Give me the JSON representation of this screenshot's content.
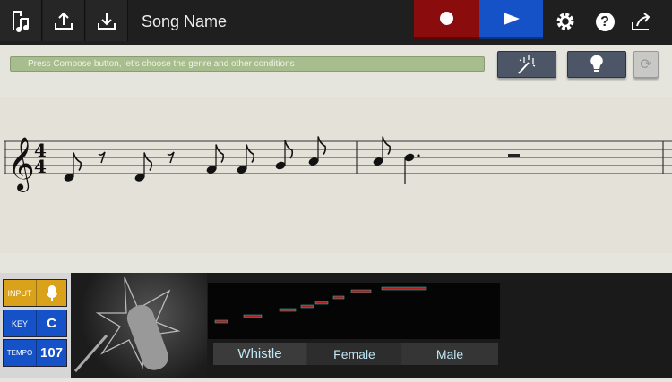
{
  "header": {
    "song_name": "Song Name",
    "icons": [
      "score-file-icon",
      "upload-icon",
      "download-icon",
      "record-icon",
      "play-icon",
      "gear-icon",
      "help-icon",
      "share-icon"
    ]
  },
  "status": {
    "message": "Press Compose button, let's choose the genre and other conditions"
  },
  "tools": {
    "icons": [
      "compose-wand-icon",
      "lightbulb-icon",
      "refresh-icon"
    ]
  },
  "score": {
    "time_signature": {
      "top": "4",
      "bottom": "4"
    },
    "notes": [
      {
        "type": "eighth",
        "pitch": "D4"
      },
      {
        "type": "eighth-rest"
      },
      {
        "type": "eighth",
        "pitch": "D4"
      },
      {
        "type": "eighth-rest"
      },
      {
        "type": "eighth",
        "pitch": "F4"
      },
      {
        "type": "eighth",
        "pitch": "F4"
      },
      {
        "type": "eighth",
        "pitch": "G4"
      },
      {
        "type": "eighth",
        "pitch": "A4"
      },
      {
        "type": "bar"
      },
      {
        "type": "eighth",
        "pitch": "A4"
      },
      {
        "type": "dotted-quarter",
        "pitch": "B4"
      },
      {
        "type": "half-rest"
      },
      {
        "type": "bar"
      }
    ]
  },
  "controls": {
    "input_label": "INPUT",
    "key_label": "KEY",
    "key_value": "C",
    "tempo_label": "TEMPO",
    "tempo_value": "107"
  },
  "voices": [
    {
      "label": "Whistle",
      "selected": true
    },
    {
      "label": "Female"
    },
    {
      "label": "Male"
    }
  ],
  "colors": {
    "record": "#8a0c0c",
    "play": "#1552c8",
    "input": "#d9a21a",
    "key": "#1552c8",
    "status": "#a8bd8e"
  }
}
